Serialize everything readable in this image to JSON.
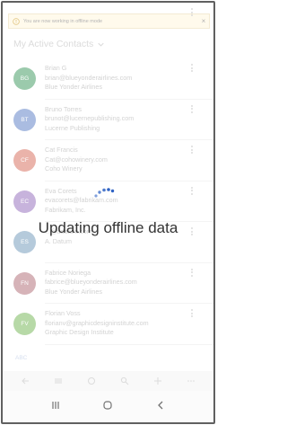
{
  "banner": {
    "text": "You are now working in offline mode"
  },
  "header": {
    "title": "My Active Contacts"
  },
  "contacts": [
    {
      "initials": "BG",
      "color": "#7ab990",
      "lines": [
        "Brian G",
        "brian@blueyonderairlines.com",
        "Blue Yonder Airlines"
      ]
    },
    {
      "initials": "BT",
      "color": "#8ea6d7",
      "lines": [
        "Bruno Torres",
        "brunot@lucernepublishing.com",
        "Lucerne Publishing"
      ]
    },
    {
      "initials": "CF",
      "color": "#e39a8e",
      "lines": [
        "Cat Francis",
        "Cat@cohowinery.com",
        "Coho Winery"
      ]
    },
    {
      "initials": "EC",
      "color": "#b59ad0",
      "lines": [
        "Eva Corets",
        "evacorets@fabrikam.com",
        "Fabrikam, Inc."
      ]
    },
    {
      "initials": "ES",
      "color": "#9cb8cf",
      "lines": [
        "",
        "...@adatum.com",
        "A. Datum"
      ]
    },
    {
      "initials": "FN",
      "color": "#c99aa0",
      "lines": [
        "Fabrice Noriega",
        "fabrice@blueyonderairlines.com",
        "Blue Yonder Airlines"
      ]
    },
    {
      "initials": "FV",
      "color": "#9fcc8a",
      "lines": [
        "Florian Voss",
        "florianv@graphicdesigninstitute.com",
        "Graphic Design Institute"
      ]
    }
  ],
  "footer": {
    "abc": "ABC"
  },
  "overlay": {
    "message": "Updating offline data"
  }
}
